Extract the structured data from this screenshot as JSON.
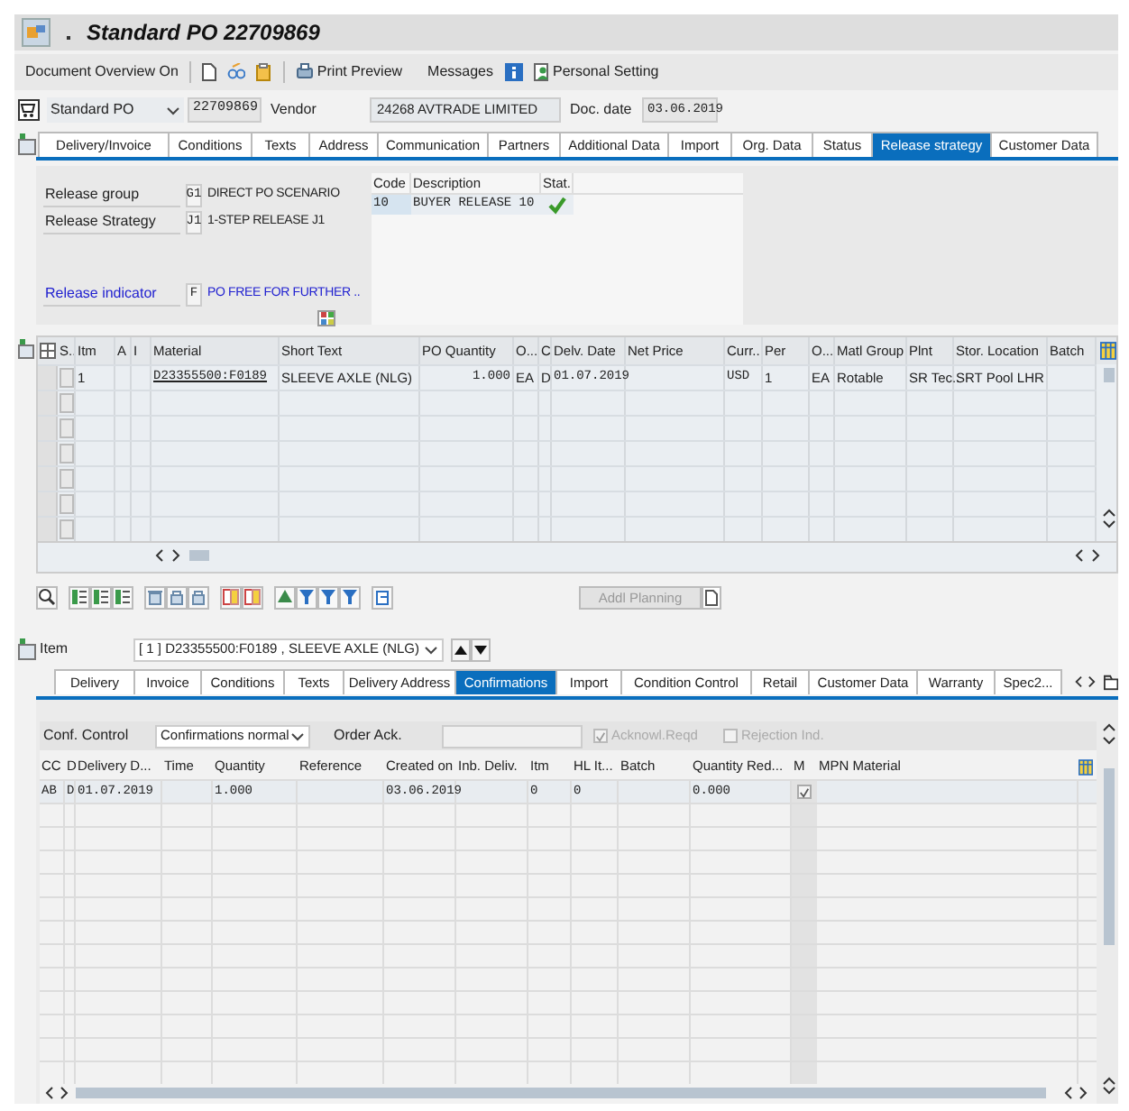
{
  "window": {
    "title": "Standard PO 22709869"
  },
  "toolbar": {
    "document_overview": "Document Overview On",
    "print_preview": "Print Preview",
    "messages": "Messages",
    "personal_setting": "Personal Setting"
  },
  "header": {
    "doc_type": "Standard PO",
    "po_number": "22709869",
    "vendor_label": "Vendor",
    "vendor": "24268 AVTRADE LIMITED",
    "doc_date_label": "Doc. date",
    "doc_date": "03.06.2019"
  },
  "header_tabs": [
    {
      "label": "Delivery/Invoice",
      "selected": false
    },
    {
      "label": "Conditions",
      "selected": false
    },
    {
      "label": "Texts",
      "selected": false
    },
    {
      "label": "Address",
      "selected": false
    },
    {
      "label": "Communication",
      "selected": false
    },
    {
      "label": "Partners",
      "selected": false
    },
    {
      "label": "Additional Data",
      "selected": false
    },
    {
      "label": "Import",
      "selected": false
    },
    {
      "label": "Org. Data",
      "selected": false
    },
    {
      "label": "Status",
      "selected": false
    },
    {
      "label": "Release strategy",
      "selected": true
    },
    {
      "label": "Customer Data",
      "selected": false
    }
  ],
  "release": {
    "fields": [
      {
        "kind": "plain",
        "label": "Release group",
        "code": "G1",
        "text": "DIRECT PO SCENARIO"
      },
      {
        "kind": "plain",
        "label": "Release Strategy",
        "code": "J1",
        "text": "1-STEP RELEASE J1"
      },
      {
        "kind": "link",
        "label": "Release indicator",
        "code": "F",
        "text": "PO FREE FOR FURTHER .."
      }
    ],
    "table": {
      "columns": [
        "Code",
        "Description",
        "Stat."
      ],
      "rows": [
        {
          "code": "10",
          "description": "BUYER RELEASE 10",
          "released": true
        }
      ]
    }
  },
  "items_table": {
    "columns": [
      "S..",
      "Itm",
      "A",
      "I",
      "Material",
      "Short Text",
      "PO Quantity",
      "O...",
      "C",
      "Delv. Date",
      "Net Price",
      "Curr...",
      "Per",
      "O...",
      "Matl Group",
      "Plnt",
      "Stor. Location",
      "Batch"
    ],
    "rows": [
      {
        "selected": false,
        "checked": false,
        "cells": [
          null,
          "1",
          null,
          null,
          "D23355500:F0189",
          "SLEEVE AXLE (NLG)",
          "1.000",
          "EA",
          "D",
          "01.07.2019",
          null,
          "USD",
          "1",
          "EA",
          "Rotable",
          "SR Tec..",
          "SRT Pool LHR",
          null
        ]
      },
      {
        "selected": false,
        "checked": false
      },
      {
        "selected": false,
        "checked": false
      },
      {
        "selected": false,
        "checked": false
      },
      {
        "selected": false,
        "checked": false
      },
      {
        "selected": false,
        "checked": false
      },
      {
        "selected": false,
        "checked": false
      }
    ]
  },
  "addl_planning": {
    "label": "Addl Planning",
    "disabled": true
  },
  "item_selector": {
    "label": "Item",
    "value": "[ 1 ] D23355500:F0189 , SLEEVE AXLE (NLG)"
  },
  "item_tabs": [
    {
      "label": "Delivery",
      "selected": false
    },
    {
      "label": "Invoice",
      "selected": false
    },
    {
      "label": "Conditions",
      "selected": false
    },
    {
      "label": "Texts",
      "selected": false
    },
    {
      "label": "Delivery Address",
      "selected": false
    },
    {
      "label": "Confirmations",
      "selected": true
    },
    {
      "label": "Import",
      "selected": false
    },
    {
      "label": "Condition Control",
      "selected": false
    },
    {
      "label": "Retail",
      "selected": false
    },
    {
      "label": "Customer Data",
      "selected": false
    },
    {
      "label": "Warranty",
      "selected": false
    },
    {
      "label": "Spec2...",
      "selected": false
    }
  ],
  "confirmations": {
    "conf_control_label": "Conf. Control",
    "conf_control": "Confirmations normal",
    "order_ack_label": "Order Ack.",
    "checkboxes": [
      {
        "label": "Acknowl.Reqd",
        "checked": true,
        "disabled": true
      },
      {
        "label": "Rejection Ind.",
        "checked": false,
        "disabled": true
      }
    ],
    "columns": [
      "CC",
      "D",
      "Delivery D...",
      "Time",
      "Quantity",
      "Reference",
      "Created on",
      "Inb. Deliv.",
      "Itm",
      "HL It...",
      "Batch",
      "Quantity Red...",
      "M",
      "MPN Material"
    ],
    "rows": [
      {
        "cells": [
          "AB",
          "D",
          "01.07.2019",
          null,
          "1.000",
          null,
          "03.06.2019",
          null,
          "0",
          "0",
          null,
          "0.000",
          null,
          null
        ],
        "m_checked": true
      }
    ]
  }
}
